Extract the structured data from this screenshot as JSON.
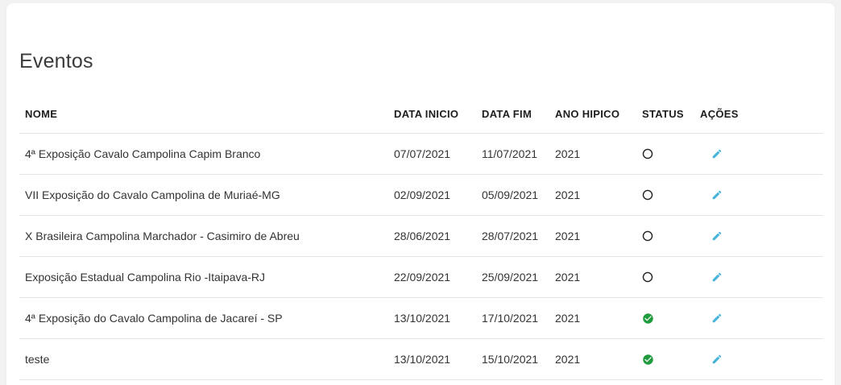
{
  "page": {
    "title": "Eventos"
  },
  "table": {
    "headers": {
      "nome": "NOME",
      "data_inicio": "DATA INICIO",
      "data_fim": "DATA FIM",
      "ano_hipico": "ANO HIPICO",
      "status": "STATUS",
      "acoes": "AÇÕES"
    },
    "rows": [
      {
        "nome": "4ª Exposição Cavalo Campolina Capim Branco",
        "data_inicio": "07/07/2021",
        "data_fim": "11/07/2021",
        "ano_hipico": "2021",
        "status_icon": "circle-outline-icon",
        "action_icon": "pencil-icon"
      },
      {
        "nome": "VII Exposição do Cavalo Campolina de Muriaé-MG",
        "data_inicio": "02/09/2021",
        "data_fim": "05/09/2021",
        "ano_hipico": "2021",
        "status_icon": "circle-outline-icon",
        "action_icon": "pencil-icon"
      },
      {
        "nome": "X Brasileira Campolina Marchador - Casimiro de Abreu",
        "data_inicio": "28/06/2021",
        "data_fim": "28/07/2021",
        "ano_hipico": "2021",
        "status_icon": "circle-outline-icon",
        "action_icon": "pencil-icon"
      },
      {
        "nome": "Exposição Estadual Campolina Rio -Itaipava-RJ",
        "data_inicio": "22/09/2021",
        "data_fim": "25/09/2021",
        "ano_hipico": "2021",
        "status_icon": "circle-outline-icon",
        "action_icon": "pencil-icon"
      },
      {
        "nome": "4ª Exposição do Cavalo Campolina de Jacareí - SP",
        "data_inicio": "13/10/2021",
        "data_fim": "17/10/2021",
        "ano_hipico": "2021",
        "status_icon": "check-circle-icon",
        "action_icon": "pencil-icon"
      },
      {
        "nome": "teste",
        "data_inicio": "13/10/2021",
        "data_fim": "15/10/2021",
        "ano_hipico": "2021",
        "status_icon": "check-circle-icon",
        "action_icon": "pencil-icon"
      }
    ]
  },
  "colors": {
    "page_background": "#f2f2f2",
    "card_background": "#ffffff",
    "title": "#3a3a3a",
    "text": "#333333",
    "header_text": "#1d1d1d",
    "divider": "#e5e5e5",
    "status_active": "#1f9b3d",
    "status_inactive": "#222222",
    "action_icon": "#45b3da"
  }
}
